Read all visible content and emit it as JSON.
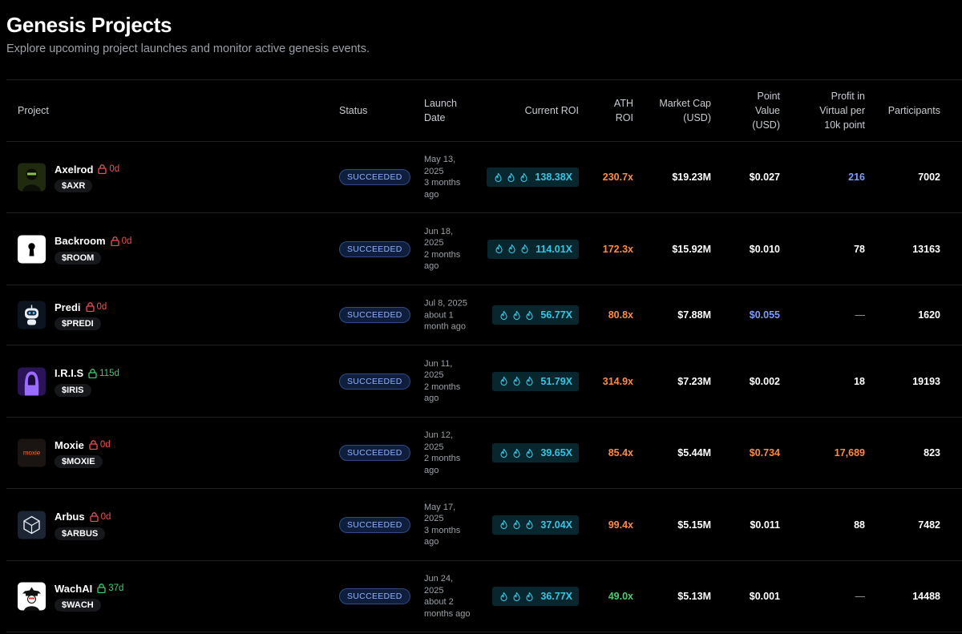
{
  "page": {
    "title": "Genesis Projects",
    "subtitle": "Explore upcoming project launches and monitor active genesis events."
  },
  "columns": {
    "project": "Project",
    "status": "Status",
    "launch": [
      "Launch",
      "Date"
    ],
    "current_roi": "Current ROI",
    "ath_roi": [
      "ATH",
      "ROI"
    ],
    "market_cap": [
      "Market Cap",
      "(USD)"
    ],
    "point_value": [
      "Point",
      "Value",
      "(USD)"
    ],
    "profit": [
      "Profit in",
      "Virtual per",
      "10k point"
    ],
    "participants": "Participants"
  },
  "colors": {
    "status_bg": "#0f1e3d",
    "roi_cyan": "#35c6e4",
    "orange": "#ff8a45",
    "green": "#43d167",
    "blue": "#7c9dff",
    "lock_red": "#f04f4f",
    "lock_green": "#3ecf6e"
  },
  "rows": [
    {
      "name": "Axelrod",
      "lock_label": "0d",
      "lock_state": "red",
      "ticker": "$AXR",
      "avatar_icon": "hooded-figure-icon",
      "status": "SUCCEEDED",
      "launch": [
        "May 13,",
        "2025",
        "3 months",
        "ago"
      ],
      "current_roi": "138.38X",
      "ath_roi": "230.7x",
      "ath_color": "orange",
      "market_cap": "$19.23M",
      "point_value": "$0.027",
      "point_color": "white",
      "profit": "216",
      "profit_color": "blue",
      "participants": "7002"
    },
    {
      "name": "Backroom",
      "lock_label": "0d",
      "lock_state": "red",
      "ticker": "$ROOM",
      "avatar_icon": "keyhole-icon",
      "status": "SUCCEEDED",
      "launch": [
        "Jun 18,",
        "2025",
        "2 months",
        "ago"
      ],
      "current_roi": "114.01X",
      "ath_roi": "172.3x",
      "ath_color": "orange",
      "market_cap": "$15.92M",
      "point_value": "$0.010",
      "point_color": "white",
      "profit": "78",
      "profit_color": "white",
      "participants": "13163"
    },
    {
      "name": "Predi",
      "lock_label": "0d",
      "lock_state": "red",
      "ticker": "$PREDI",
      "avatar_icon": "robot-icon",
      "status": "SUCCEEDED",
      "launch": [
        "Jul 8, 2025",
        "about 1",
        "month ago"
      ],
      "current_roi": "56.77X",
      "ath_roi": "80.8x",
      "ath_color": "orange",
      "market_cap": "$7.88M",
      "point_value": "$0.055",
      "point_color": "blue",
      "profit": "—",
      "profit_color": "dash",
      "participants": "1620"
    },
    {
      "name": "I.R.I.S",
      "lock_label": "115d",
      "lock_state": "green",
      "ticker": "$IRIS",
      "avatar_icon": "hooded-figure-purple-icon",
      "status": "SUCCEEDED",
      "launch": [
        "Jun 11,",
        "2025",
        "2 months",
        "ago"
      ],
      "current_roi": "51.79X",
      "ath_roi": "314.9x",
      "ath_color": "orange",
      "market_cap": "$7.23M",
      "point_value": "$0.002",
      "point_color": "white",
      "profit": "18",
      "profit_color": "white",
      "participants": "19193"
    },
    {
      "name": "Moxie",
      "lock_label": "0d",
      "lock_state": "red",
      "ticker": "$MOXIE",
      "avatar_icon": "moxie-logo-icon",
      "avatar_text": "moxie",
      "status": "SUCCEEDED",
      "launch": [
        "Jun 12,",
        "2025",
        "2 months",
        "ago"
      ],
      "current_roi": "39.65X",
      "ath_roi": "85.4x",
      "ath_color": "orange",
      "market_cap": "$5.44M",
      "point_value": "$0.734",
      "point_color": "orange",
      "profit": "17,689",
      "profit_color": "orange",
      "participants": "823"
    },
    {
      "name": "Arbus",
      "lock_label": "0d",
      "lock_state": "red",
      "ticker": "$ARBUS",
      "avatar_icon": "cube-logo-icon",
      "status": "SUCCEEDED",
      "launch": [
        "May 17,",
        "2025",
        "3 months",
        "ago"
      ],
      "current_roi": "37.04X",
      "ath_roi": "99.4x",
      "ath_color": "orange",
      "market_cap": "$5.15M",
      "point_value": "$0.011",
      "point_color": "white",
      "profit": "88",
      "profit_color": "white",
      "participants": "7482"
    },
    {
      "name": "WachAI",
      "lock_label": "37d",
      "lock_state": "green",
      "ticker": "$WACH",
      "avatar_icon": "detective-icon",
      "status": "SUCCEEDED",
      "launch": [
        "Jun 24,",
        "2025",
        "about 2",
        "months ago"
      ],
      "current_roi": "36.77X",
      "ath_roi": "49.0x",
      "ath_color": "green",
      "market_cap": "$5.13M",
      "point_value": "$0.001",
      "point_color": "white",
      "profit": "—",
      "profit_color": "dash",
      "participants": "14488"
    }
  ]
}
